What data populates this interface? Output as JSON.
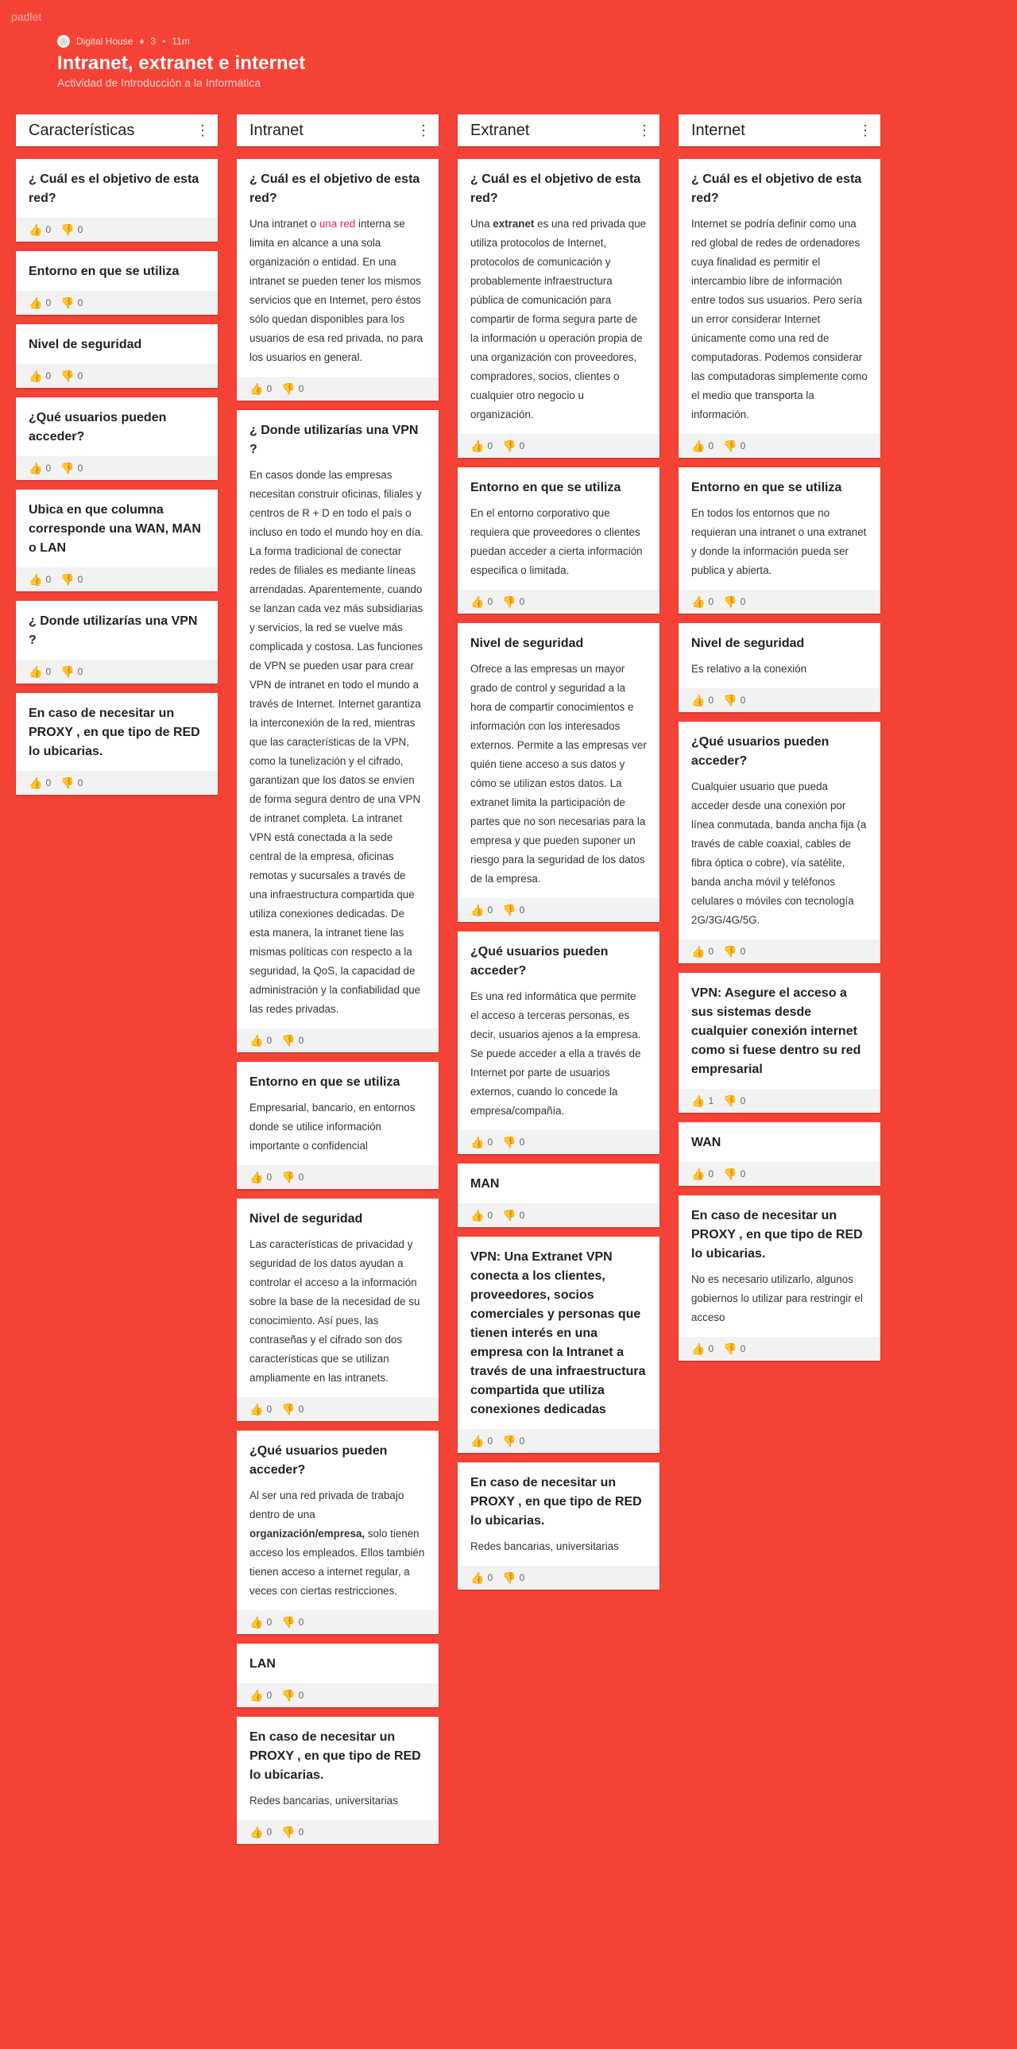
{
  "brand": "padlet",
  "header": {
    "author": "Digital House",
    "likes": "3",
    "time": "11m",
    "title": "Intranet, extranet e internet",
    "subtitle": "Actividad de Introducción a la Informática"
  },
  "icons": {
    "like": "thumbs-up-icon",
    "dislike": "thumbs-down-icon",
    "menu": "vertical-dots-icon"
  },
  "columns": [
    {
      "title": "Características",
      "cards": [
        {
          "title": "¿ Cuál es el objetivo de esta red?",
          "text": "",
          "likes": "0",
          "dislikes": "0"
        },
        {
          "title": "Entorno en que se utiliza",
          "text": "",
          "likes": "0",
          "dislikes": "0"
        },
        {
          "title": "Nivel de seguridad",
          "text": "",
          "likes": "0",
          "dislikes": "0"
        },
        {
          "title": "¿Qué usuarios pueden acceder?",
          "text": "",
          "likes": "0",
          "dislikes": "0"
        },
        {
          "title": "Ubica en que columna corresponde una WAN, MAN o LAN",
          "text": "",
          "likes": "0",
          "dislikes": "0"
        },
        {
          "title": "¿ Donde utilizarías una VPN ?",
          "text": "",
          "likes": "0",
          "dislikes": "0"
        },
        {
          "title": "En caso de necesitar un PROXY , en que tipo de RED lo ubicarias.",
          "text": "",
          "likes": "0",
          "dislikes": "0"
        }
      ]
    },
    {
      "title": "Intranet",
      "cards": [
        {
          "title": "¿ Cuál es el objetivo de esta red?",
          "text_pre": "Una intranet o ",
          "link": "una red",
          "text": " interna se limita en alcance a una sola organización o entidad. En una intranet se pueden tener los mismos servicios que en Internet, pero éstos sólo quedan disponibles para los usuarios de esa red privada, no para los usuarios en general.",
          "likes": "0",
          "dislikes": "0"
        },
        {
          "title": "¿ Donde utilizarías una VPN ?",
          "text": "En casos donde las empresas necesitan construir oficinas, filiales y centros de R + D en todo el país o incluso en todo el mundo hoy en día. La forma tradicional de conectar redes de filiales es mediante líneas arrendadas. Aparentemente, cuando se lanzan cada vez más subsidiarias y servicios, la red se vuelve más complicada y costosa. Las funciones de VPN se pueden usar para crear VPN de intranet en todo el mundo a través de Internet. Internet garantiza la interconexión de la red, mientras que las características de la VPN, como la tunelización y el cifrado, garantizan que los datos se envíen de forma segura dentro de una VPN de intranet completa. La intranet VPN está conectada a la sede central de la empresa, oficinas remotas y sucursales a través de una infraestructura compartida que utiliza conexiones dedicadas. De esta manera, la intranet tiene las mismas políticas con respecto a la seguridad, la QoS, la capacidad de administración y la confiabilidad que las redes privadas.",
          "likes": "0",
          "dislikes": "0"
        },
        {
          "title": "Entorno en que se utiliza",
          "text": "Empresarial, bancario, en entornos donde se utilice información importante o confidencial",
          "likes": "0",
          "dislikes": "0"
        },
        {
          "title": "Nivel de seguridad",
          "text": "Las características de privacidad y seguridad de los datos ayudan a controlar el acceso a la información sobre la base de la necesidad de su conocimiento. Así pues, las contraseñas y el cifrado son dos características que se utilizan ampliamente en las intranets.",
          "likes": "0",
          "dislikes": "0"
        },
        {
          "title": "¿Qué usuarios pueden acceder?",
          "text_pre": "Al ser una red privada de trabajo dentro de una ",
          "bold": "organización/empresa,",
          "text": " solo tienen acceso los empleados.  Ellos también tienen acceso a internet regular, a veces con ciertas restricciones.",
          "likes": "0",
          "dislikes": "0"
        },
        {
          "title": "LAN",
          "text": "",
          "likes": "0",
          "dislikes": "0"
        },
        {
          "title": "En caso de necesitar un PROXY , en que tipo de RED lo ubicarias.",
          "text": "Redes bancarias, universitarias",
          "likes": "0",
          "dislikes": "0"
        }
      ]
    },
    {
      "title": "Extranet",
      "cards": [
        {
          "title": "¿ Cuál es el objetivo de esta red?",
          "text_pre": "Una ",
          "bold": "extranet",
          "text": " es una red privada que utiliza protocolos de Internet, protocolos de comunicación y probablemente infraestructura pública de comunicación para compartir de forma segura parte de la información u operación propia de una organización con proveedores, compradores, socios, clientes o cualquier otro negocio u organización.",
          "likes": "0",
          "dislikes": "0"
        },
        {
          "title": "Entorno en que se utiliza",
          "text": "En el entorno corporativo que requiera que proveedores o clientes  puedan acceder a cierta información especifica o limitada.",
          "likes": "0",
          "dislikes": "0"
        },
        {
          "title": "Nivel de seguridad",
          "text": "Ofrece a las empresas un mayor grado de control y seguridad a la hora de compartir conocimientos e información con los interesados externos. Permite a las empresas ver quién tiene acceso a sus datos y cómo se utilizan estos datos. La extranet limita la participación de partes que no son necesarias para la empresa y que pueden suponer un riesgo para la seguridad de los datos de la empresa.",
          "likes": "0",
          "dislikes": "0"
        },
        {
          "title": "¿Qué usuarios pueden acceder?",
          "text": "Es una red informática que permite el acceso a terceras personas, es decir, usuarios ajenos a la empresa. Se puede acceder a ella a través de Internet por parte de usuarios externos, cuando lo concede la empresa/compañía.",
          "likes": "0",
          "dislikes": "0"
        },
        {
          "title": "MAN",
          "text": "",
          "likes": "0",
          "dislikes": "0"
        },
        {
          "title": "VPN: Una Extranet VPN conecta a los clientes, proveedores, socios comerciales y personas que tienen interés en una empresa con la Intranet a través de una infraestructura compartida que utiliza conexiones dedicadas",
          "text": "",
          "likes": "0",
          "dislikes": "0"
        },
        {
          "title": "En caso de necesitar un PROXY , en que tipo de RED lo ubicarias.",
          "text": "Redes bancarias, universitarias",
          "likes": "0",
          "dislikes": "0"
        }
      ]
    },
    {
      "title": "Internet",
      "cards": [
        {
          "title": "¿ Cuál es el objetivo de esta red?",
          "text": "Internet se podría definir como una red global de redes de ordenadores cuya finalidad es permitir el intercambio libre de información entre todos sus usuarios. Pero sería un error considerar Internet únicamente como una red de computadoras. Podemos considerar las computadoras simplemente como el medio que transporta la información.",
          "likes": "0",
          "dislikes": "0"
        },
        {
          "title": "Entorno en que se utiliza",
          "text": "En todos los entornos que no requieran  una intranet o una extranet y donde la información pueda ser publica y abierta.",
          "likes": "0",
          "dislikes": "0"
        },
        {
          "title": "Nivel de seguridad",
          "text": "Es relativo a la conexión",
          "likes": "0",
          "dislikes": "0"
        },
        {
          "title": "¿Qué usuarios pueden acceder?",
          "text": "Cualquier usuario que pueda acceder desde una conexión por línea conmutada, banda ancha fija (a través de cable coaxial, cables de fibra óptica o cobre), vía satélite, banda ancha móvil y teléfonos celulares o móviles con tecnología 2G/3G/4G/5G.",
          "likes": "0",
          "dislikes": "0"
        },
        {
          "title": "VPN: Asegure el acceso a sus sistemas desde cualquier conexión internet como si fuese dentro su red empresarial",
          "text": "",
          "likes": "1",
          "dislikes": "0"
        },
        {
          "title": "WAN",
          "text": "",
          "likes": "0",
          "dislikes": "0"
        },
        {
          "title": "En caso de necesitar un PROXY , en que tipo de RED lo ubicarias.",
          "text": "No es necesario utilizarlo, algunos gobiernos lo utilizar para restringir el acceso",
          "likes": "0",
          "dislikes": "0"
        }
      ]
    }
  ]
}
